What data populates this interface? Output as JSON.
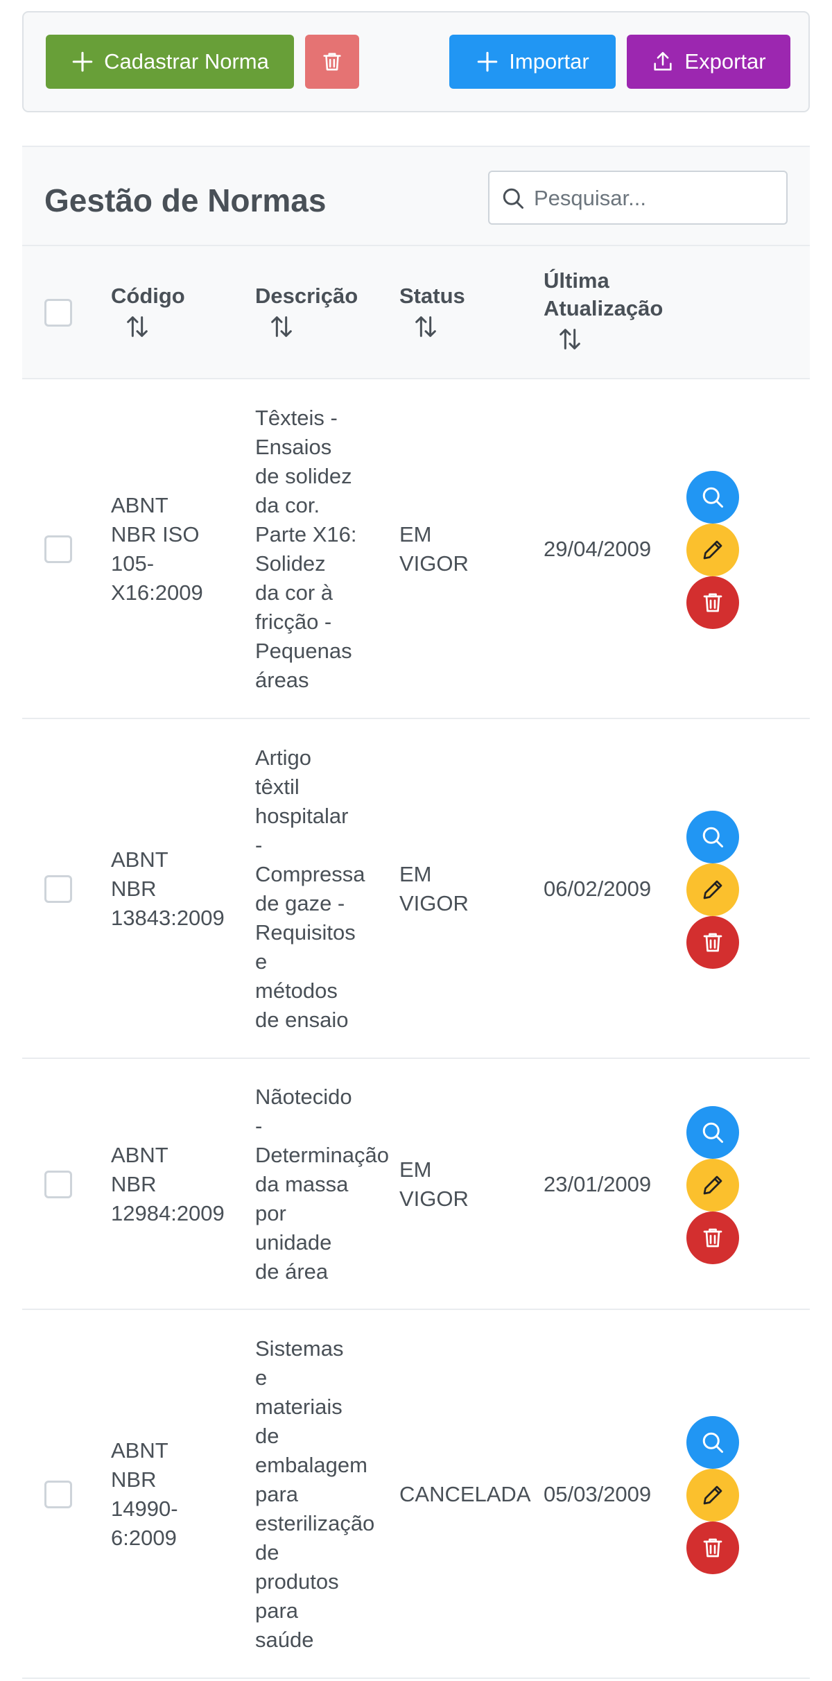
{
  "toolbar": {
    "new_label": "Cadastrar Norma",
    "import_label": "Importar",
    "export_label": "Exportar"
  },
  "header": {
    "title": "Gestão de Normas",
    "search_placeholder": "Pesquisar..."
  },
  "columns": {
    "code": "Código",
    "description": "Descrição",
    "status": "Status",
    "updated_line1": "Última",
    "updated_line2": "Atualização"
  },
  "rows": [
    {
      "code_lines": [
        "ABNT",
        "NBR ISO",
        "105-",
        "X16:2009"
      ],
      "desc_lines": [
        "Têxteis -",
        "Ensaios",
        "de solidez",
        "da cor.",
        "Parte X16:",
        "Solidez",
        "da cor à",
        "fricção -",
        "Pequenas",
        "áreas"
      ],
      "status_lines": [
        "EM",
        "VIGOR"
      ],
      "date": "29/04/2009"
    },
    {
      "code_lines": [
        "ABNT",
        "NBR",
        "13843:2009"
      ],
      "desc_lines": [
        "Artigo",
        "têxtil",
        "hospitalar",
        "-",
        "Compressa",
        "de gaze -",
        "Requisitos",
        "e",
        "métodos",
        "de ensaio"
      ],
      "status_lines": [
        "EM",
        "VIGOR"
      ],
      "date": "06/02/2009"
    },
    {
      "code_lines": [
        "ABNT",
        "NBR",
        "12984:2009"
      ],
      "desc_lines": [
        "Nãotecido",
        "-",
        "Determinação",
        "da massa",
        "por",
        "unidade",
        "de área"
      ],
      "status_lines": [
        "EM",
        "VIGOR"
      ],
      "date": "23/01/2009"
    },
    {
      "code_lines": [
        "ABNT",
        "NBR",
        "14990-",
        "6:2009"
      ],
      "desc_lines": [
        "Sistemas",
        "e",
        "materiais",
        "de",
        "embalagem",
        "para",
        "esterilização",
        "de",
        "produtos",
        "para",
        "saúde"
      ],
      "status_lines": [
        "CANCELADA"
      ],
      "date": "05/03/2009"
    }
  ],
  "colors": {
    "new": "#689f38",
    "delete_selected": "#e57373",
    "import": "#2196f3",
    "export": "#9c27b0",
    "view": "#2196f3",
    "edit": "#fbc02d",
    "delete": "#d32f2f"
  }
}
